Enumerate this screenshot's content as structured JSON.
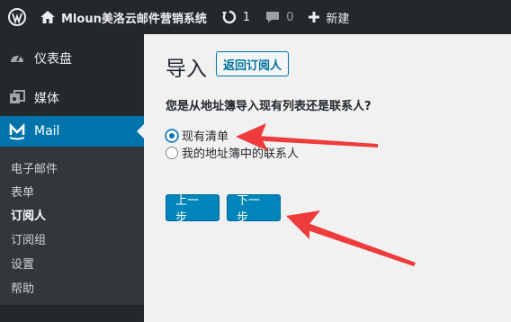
{
  "adminbar": {
    "site_name": "Mloun美洛云邮件营销系统",
    "updates_count": "1",
    "comments_count": "0",
    "new_label": "新建",
    "icons": [
      "wordpress-logo-icon",
      "home-icon",
      "updates-icon",
      "comment-icon",
      "plus-icon"
    ]
  },
  "sidebar": {
    "dashboard": "仪表盘",
    "media": "媒体",
    "mail": "Mail",
    "submenu": [
      "电子邮件",
      "表单",
      "订阅人",
      "订阅组",
      "设置",
      "帮助"
    ],
    "current": "订阅人"
  },
  "main": {
    "title": "导入",
    "back_button": "返回订阅人",
    "question": "您是从地址簿导入现有列表还是联系人?",
    "options": [
      "现有清单",
      "我的地址簿中的联系人"
    ],
    "selected_option": "现有清单",
    "prev_button": "上一步",
    "next_button": "下一步"
  },
  "colors": {
    "adminbar_bg": "#23282d",
    "submenu_bg": "#32373c",
    "accent": "#0073aa",
    "primary_button": "#0085ba",
    "annotation_arrow": "#ee3b3b"
  }
}
